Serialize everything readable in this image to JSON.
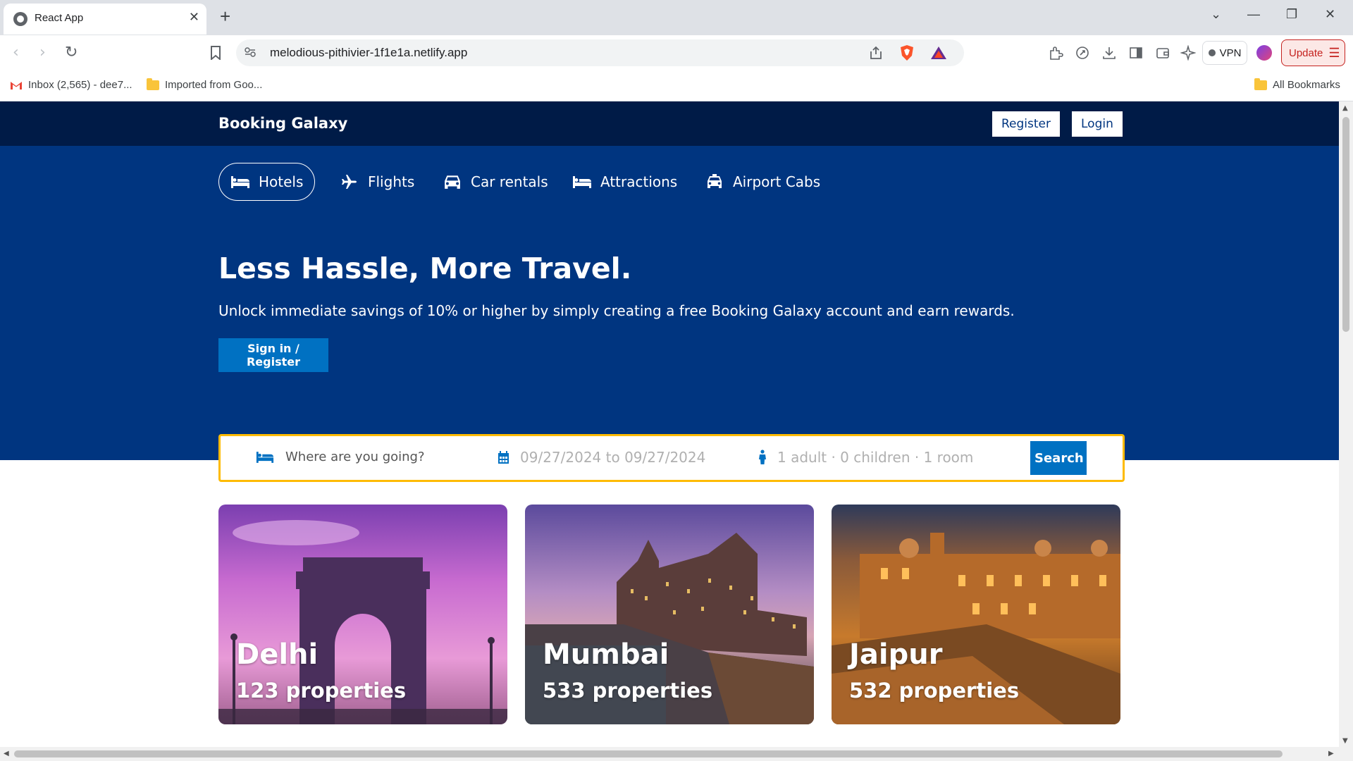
{
  "browser": {
    "tab_title": "React App",
    "url": "melodious-pithivier-1f1e1a.netlify.app",
    "vpn_label": "VPN",
    "update_label": "Update",
    "bookmarks": [
      "Inbox (2,565) - dee7...",
      "Imported from Goo..."
    ],
    "all_bookmarks": "All Bookmarks"
  },
  "header": {
    "logo": "Booking Galaxy",
    "register": "Register",
    "login": "Login"
  },
  "categories": [
    {
      "label": "Hotels",
      "icon": "bed-icon",
      "active": true
    },
    {
      "label": "Flights",
      "icon": "plane-icon",
      "active": false
    },
    {
      "label": "Car rentals",
      "icon": "car-icon",
      "active": false
    },
    {
      "label": "Attractions",
      "icon": "bed-icon",
      "active": false
    },
    {
      "label": "Airport Cabs",
      "icon": "taxi-icon",
      "active": false
    }
  ],
  "hero": {
    "title": "Less Hassle, More Travel.",
    "description": "Unlock immediate savings of 10% or higher by simply creating a free Booking Galaxy account and earn rewards.",
    "cta": "Sign in / Register"
  },
  "search": {
    "destination_placeholder": "Where are you going?",
    "dates": "09/27/2024 to 09/27/2024",
    "guests": "1 adult · 0 children · 1 room",
    "button": "Search"
  },
  "destinations": [
    {
      "city": "Delhi",
      "properties": "123 properties"
    },
    {
      "city": "Mumbai",
      "properties": "533 properties"
    },
    {
      "city": "Jaipur",
      "properties": "532 properties"
    }
  ],
  "colors": {
    "nav_dark": "#001b47",
    "brand_blue": "#003580",
    "accent_blue": "#0071c2",
    "search_border": "#febb02"
  }
}
